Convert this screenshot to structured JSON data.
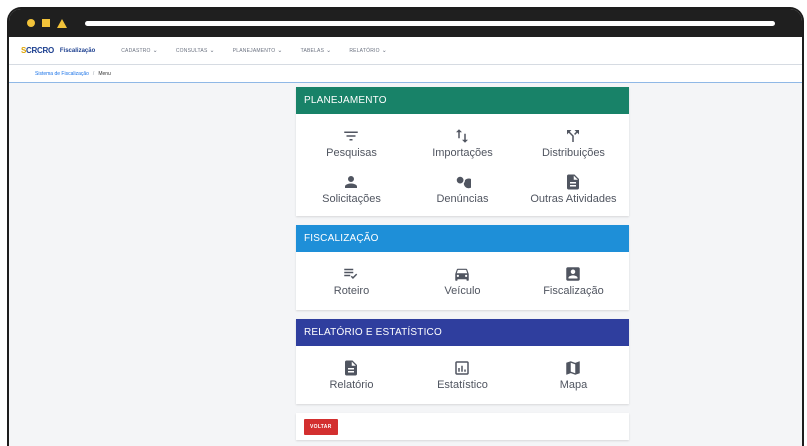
{
  "navbar": {
    "logo_text": "CRCRO",
    "logo_highlight": "S",
    "app_name": "Fiscalização",
    "menu": [
      {
        "label": "CADASTRO"
      },
      {
        "label": "CONSULTAS"
      },
      {
        "label": "PLANEJAMENTO"
      },
      {
        "label": "TABELAS"
      },
      {
        "label": "RELATÓRIO"
      }
    ]
  },
  "breadcrumb": {
    "root": "Sistema de Fiscalização",
    "separator": "/",
    "current": "Menu"
  },
  "sections": {
    "planejamento": {
      "title": "PLANEJAMENTO",
      "color": "#188268",
      "items": [
        {
          "label": "Pesquisas",
          "icon": "filter-icon"
        },
        {
          "label": "Importações",
          "icon": "sort-arrows-icon"
        },
        {
          "label": "Distribuições",
          "icon": "call-split-icon"
        },
        {
          "label": "Solicitações",
          "icon": "person-icon"
        },
        {
          "label": "Denúncias",
          "icon": "search-icon"
        },
        {
          "label": "Outras Atividades",
          "icon": "document-icon"
        }
      ]
    },
    "fiscalizacao": {
      "title": "FISCALIZAÇÃO",
      "color": "#1e8fd8",
      "items": [
        {
          "label": "Roteiro",
          "icon": "checklist-icon"
        },
        {
          "label": "Veículo",
          "icon": "car-icon"
        },
        {
          "label": "Fiscalização",
          "icon": "account-box-icon"
        }
      ]
    },
    "relatorio": {
      "title": "RELATÓRIO E ESTATÍSTICO",
      "color": "#2f3e9e",
      "items": [
        {
          "label": "Relatório",
          "icon": "document-icon"
        },
        {
          "label": "Estatístico",
          "icon": "bar-chart-icon"
        },
        {
          "label": "Mapa",
          "icon": "map-icon"
        }
      ]
    }
  },
  "footer": {
    "back_label": "VOLTAR",
    "back_color": "#d32f2f"
  }
}
